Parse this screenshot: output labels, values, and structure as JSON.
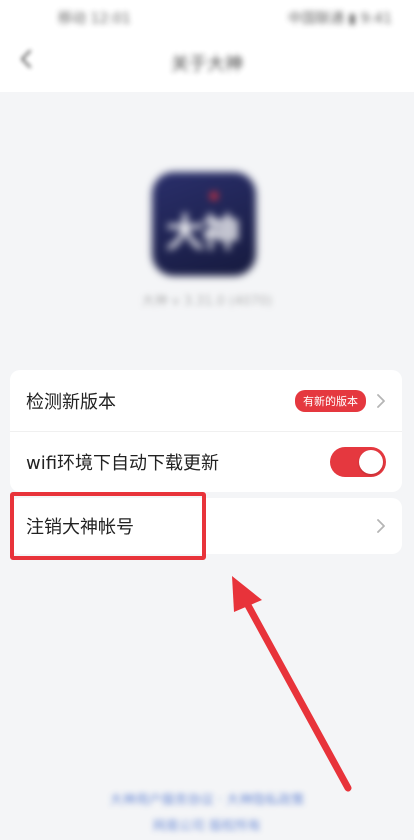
{
  "status_bar": {
    "left": "移动 12:01",
    "right": "中国联通 ▮ 9:41"
  },
  "nav": {
    "title": "关于大神"
  },
  "app": {
    "logo_text": "大神",
    "version": "大神 v 3.31.0 (4070)"
  },
  "settings": {
    "check_update": {
      "label": "检测新版本",
      "badge": "有新的版本"
    },
    "wifi_update": {
      "label": "wifi环境下自动下载更新",
      "enabled": true
    },
    "cancel_account": {
      "label": "注销大神帐号"
    }
  },
  "footer": {
    "line1": "大神用户服务协议 · 大神隐私政策",
    "line2": "网易公司 版权所有"
  },
  "colors": {
    "accent": "#e5383f",
    "annotation": "#e8333a",
    "background": "#f4f5f7"
  }
}
